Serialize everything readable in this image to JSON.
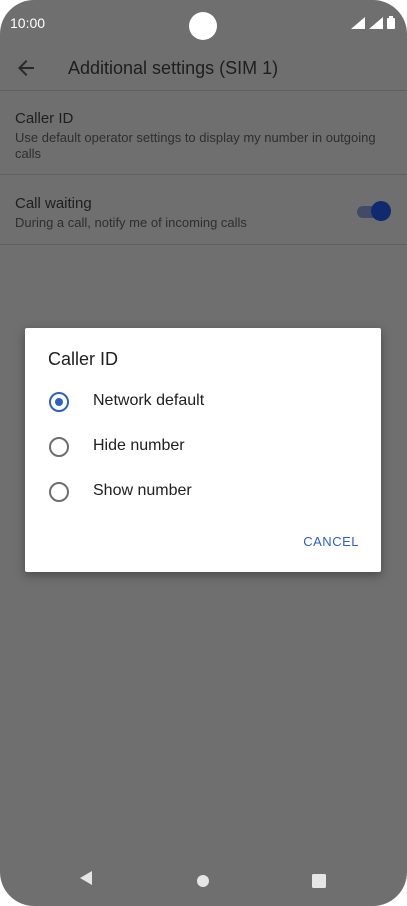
{
  "status_bar": {
    "time": "10:00"
  },
  "app_bar": {
    "title": "Additional settings (SIM 1)"
  },
  "settings": {
    "caller_id": {
      "title": "Caller ID",
      "subtitle": "Use default operator settings to display my number in outgoing calls"
    },
    "call_waiting": {
      "title": "Call waiting",
      "subtitle": "During a call, notify me of incoming calls",
      "enabled": true
    }
  },
  "dialog": {
    "title": "Caller ID",
    "options": [
      {
        "label": "Network default",
        "selected": true
      },
      {
        "label": "Hide number",
        "selected": false
      },
      {
        "label": "Show number",
        "selected": false
      }
    ],
    "cancel_label": "CANCEL"
  },
  "colors": {
    "accent": "#2f5fc4",
    "scrim_background": "#6f6f6f",
    "toggle_thumb": "#0f2a6d"
  },
  "icons": {
    "back": "arrow-back-icon",
    "signal": "cell-signal-icon",
    "wifi": "wifi-icon",
    "battery": "battery-icon",
    "nav_back": "nav-back-icon",
    "nav_home": "nav-home-icon",
    "nav_recents": "nav-recents-icon"
  }
}
